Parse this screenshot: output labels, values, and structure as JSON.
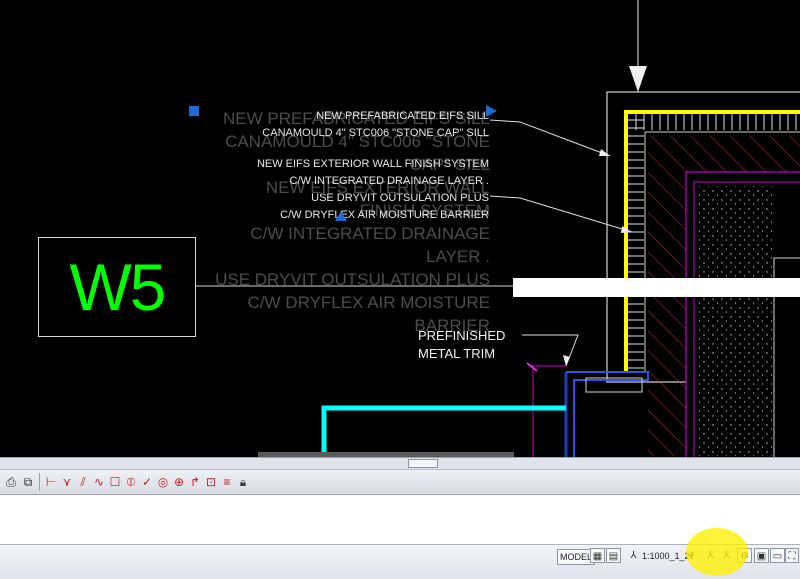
{
  "drawing": {
    "tag_label": "W5",
    "ghost_text": [
      "NEW PREFABRICATED EIFS SILL",
      "CANAMOULD 4\" STC006 \"STONE",
      "CAP\" SILL",
      "NEW EIFS EXTERIOR WALL",
      "FINISH SYSTEM",
      "C/W INTEGRATED DRAINAGE",
      "LAYER .",
      "USE DRYVIT OUTSULATION PLUS",
      "C/W DRYFLEX AIR MOISTURE",
      "BARRIER"
    ],
    "note_sill": [
      "NEW PREFABRICATED EIFS SILL",
      "CANAMOULD 4\" STC006 \"STONE CAP\" SILL"
    ],
    "note_wall": [
      "NEW EIFS EXTERIOR WALL FINISH SYSTEM",
      "C/W INTEGRATED DRAINAGE LAYER .",
      "USE DRYVIT OUTSULATION PLUS",
      "C/W DRYFLEX AIR MOISTURE BARRIER"
    ],
    "note_trim": [
      "PREFINISHED",
      "METAL TRIM"
    ],
    "colors": {
      "tag": "#00ff00",
      "sill_outline": "#ffff00",
      "interior": "#c800c8",
      "hatch": "#c03030",
      "curb": "#00ffff",
      "grip": "#1e6ad6"
    }
  },
  "toolbar": {
    "icons": [
      "print-icon",
      "copy-icon",
      "paste-icon",
      "linear-dim-icon",
      "aligned-dim-icon",
      "arc-length-icon",
      "ordinate-icon",
      "radius-icon",
      "diameter-icon",
      "angular-icon",
      "quick-dim-icon",
      "baseline-icon",
      "continue-icon",
      "center-mark-icon",
      "tolerance-icon",
      "leader-icon",
      "dim-edit-icon",
      "lock-icon"
    ]
  },
  "status": {
    "model_label": "MODEL",
    "scale_label": "1:1000_1_27",
    "dropdown_caret": "▾"
  }
}
